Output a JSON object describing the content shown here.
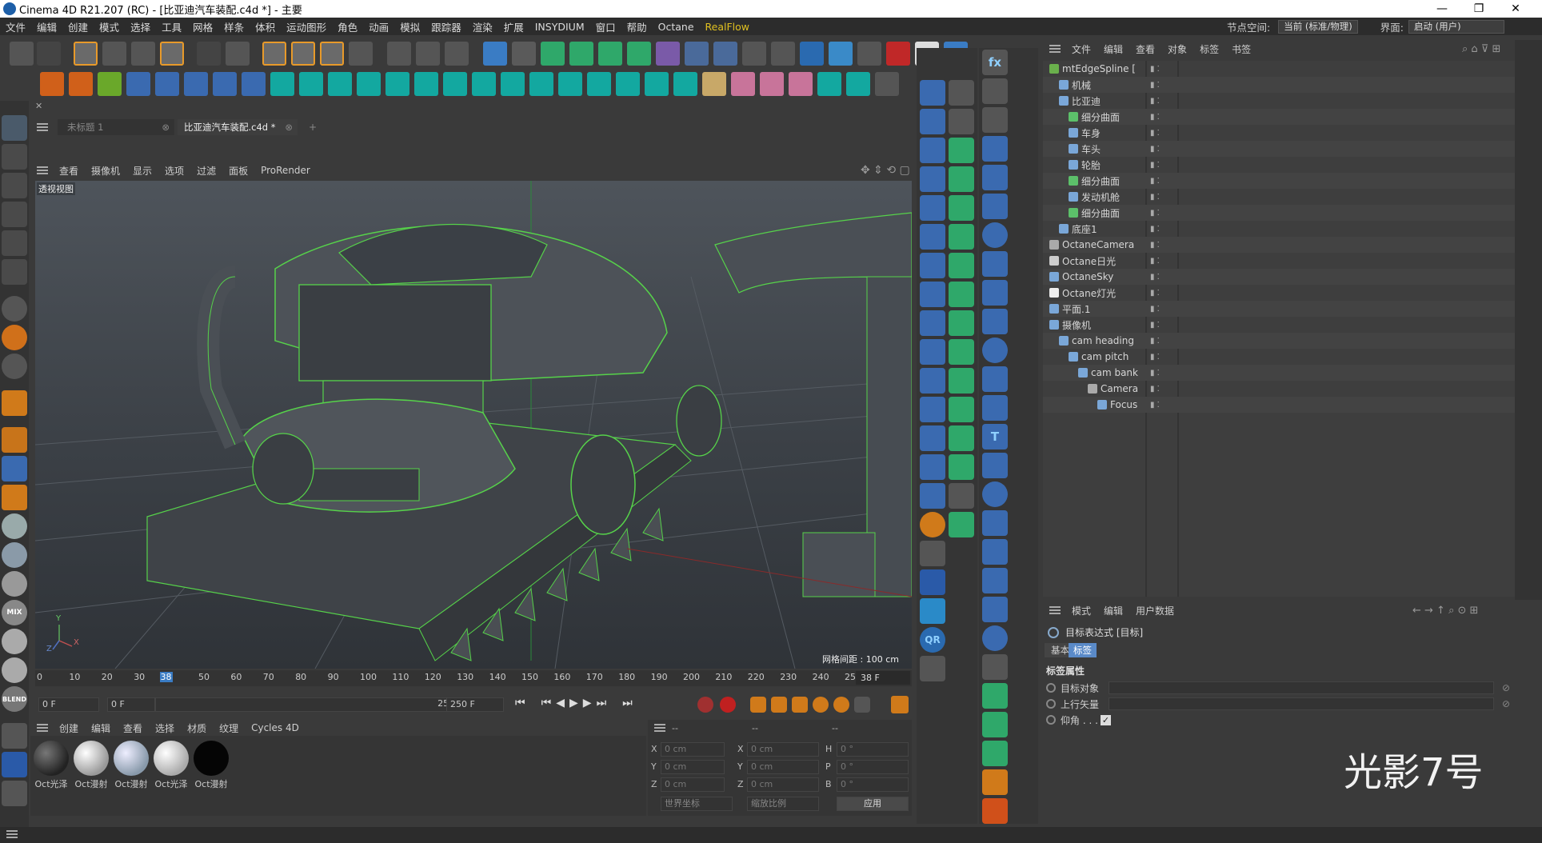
{
  "title": {
    "text": "Cinema 4D R21.207 (RC) - [比亚迪汽车装配.c4d *] - 主要",
    "min": "—",
    "max": "❐",
    "close": "✕"
  },
  "menu": {
    "items": [
      "文件",
      "编辑",
      "创建",
      "模式",
      "选择",
      "工具",
      "网格",
      "样条",
      "体积",
      "运动图形",
      "角色",
      "动画",
      "模拟",
      "跟踪器",
      "渲染",
      "扩展",
      "INSYDIUM",
      "窗口",
      "帮助",
      "Octane",
      "RealFlow"
    ],
    "node_space_label": "节点空间:",
    "node_space_value": "当前 (标准/物理)",
    "layout_label": "界面:",
    "layout_value": "启动 (用户)"
  },
  "tabs": {
    "tab1": "未标题 1",
    "tab2": "比亚迪汽车装配.c4d *",
    "add": "+"
  },
  "viewport_menu": {
    "items": [
      "查看",
      "摄像机",
      "显示",
      "选项",
      "过滤",
      "面板",
      "ProRender"
    ],
    "label": "透视视图",
    "grid": "网格间距 : 100 cm",
    "axis_y": "Y",
    "axis_z": "Z",
    "axis_x": "X"
  },
  "timeline": {
    "ticks": [
      "0",
      "10",
      "20",
      "30",
      "38",
      "50",
      "60",
      "70",
      "80",
      "90",
      "100",
      "110",
      "120",
      "130",
      "140",
      "150",
      "160",
      "170",
      "180",
      "190",
      "200",
      "210",
      "220",
      "230",
      "240",
      "250"
    ],
    "current_frame": "38 F",
    "start": "0 F",
    "start2": "0 F",
    "end": "250 F",
    "end2": "250 F",
    "current_value": 38,
    "max_frame": 250
  },
  "materials": {
    "menu": [
      "创建",
      "编辑",
      "查看",
      "选择",
      "材质",
      "纹理",
      "Cycles 4D"
    ],
    "items": [
      "Oct光泽",
      "Oct漫射",
      "Oct漫射",
      "Oct光泽",
      "Oct漫射"
    ]
  },
  "coords": {
    "header": [
      "--",
      "--",
      "--"
    ],
    "rows": [
      [
        "X",
        "0 cm",
        "X",
        "0 cm",
        "H",
        "0 °"
      ],
      [
        "Y",
        "0 cm",
        "Y",
        "0 cm",
        "P",
        "0 °"
      ],
      [
        "Z",
        "0 cm",
        "Z",
        "0 cm",
        "B",
        "0 °"
      ]
    ],
    "world": "世界坐标",
    "scale": "缩放比例",
    "apply": "应用"
  },
  "objmgr": {
    "menu": [
      "文件",
      "编辑",
      "查看",
      "对象",
      "标签",
      "书签"
    ],
    "items": [
      {
        "label": "mtEdgeSpline [",
        "indent": 0,
        "icon": "#6ab04c"
      },
      {
        "label": "机械",
        "indent": 1,
        "icon": "#7aa7d8"
      },
      {
        "label": "比亚迪",
        "indent": 1,
        "icon": "#7aa7d8"
      },
      {
        "label": "细分曲面",
        "indent": 2,
        "icon": "#5cc06a"
      },
      {
        "label": "车身",
        "indent": 2,
        "icon": "#7aa7d8"
      },
      {
        "label": "车头",
        "indent": 2,
        "icon": "#7aa7d8"
      },
      {
        "label": "轮胎",
        "indent": 2,
        "icon": "#7aa7d8"
      },
      {
        "label": "细分曲面",
        "indent": 2,
        "icon": "#5cc06a"
      },
      {
        "label": "发动机舱",
        "indent": 2,
        "icon": "#7aa7d8"
      },
      {
        "label": "细分曲面",
        "indent": 2,
        "icon": "#5cc06a"
      },
      {
        "label": "底座1",
        "indent": 1,
        "icon": "#7aa7d8"
      },
      {
        "label": "OctaneCamera",
        "indent": 0,
        "icon": "#aaaaaa"
      },
      {
        "label": "Octane日光",
        "indent": 0,
        "icon": "#cccccc"
      },
      {
        "label": "OctaneSky",
        "indent": 0,
        "icon": "#7aa7d8"
      },
      {
        "label": "Octane灯光",
        "indent": 0,
        "icon": "#eeeeee"
      },
      {
        "label": "平面.1",
        "indent": 0,
        "icon": "#7aa7d8"
      },
      {
        "label": "摄像机",
        "indent": 0,
        "icon": "#7aa7d8"
      },
      {
        "label": "cam heading",
        "indent": 1,
        "icon": "#7aa7d8"
      },
      {
        "label": "cam pitch",
        "indent": 2,
        "icon": "#7aa7d8"
      },
      {
        "label": "cam bank",
        "indent": 3,
        "icon": "#7aa7d8"
      },
      {
        "label": "Camera",
        "indent": 4,
        "icon": "#aaaaaa"
      },
      {
        "label": "Focus",
        "indent": 5,
        "icon": "#7aa7d8"
      }
    ]
  },
  "attr": {
    "menu": [
      "模式",
      "编辑",
      "用户数据"
    ],
    "title": "目标表达式 [目标]",
    "tab_basic": "基本",
    "tab_tag": "标签",
    "section": "标签属性",
    "fields": [
      "目标对象",
      "上行矢量",
      "仰角 . . ."
    ]
  },
  "watermark": "光影7号",
  "colors": {
    "wire": "#56d24a",
    "accent": "#3a7cc4"
  }
}
